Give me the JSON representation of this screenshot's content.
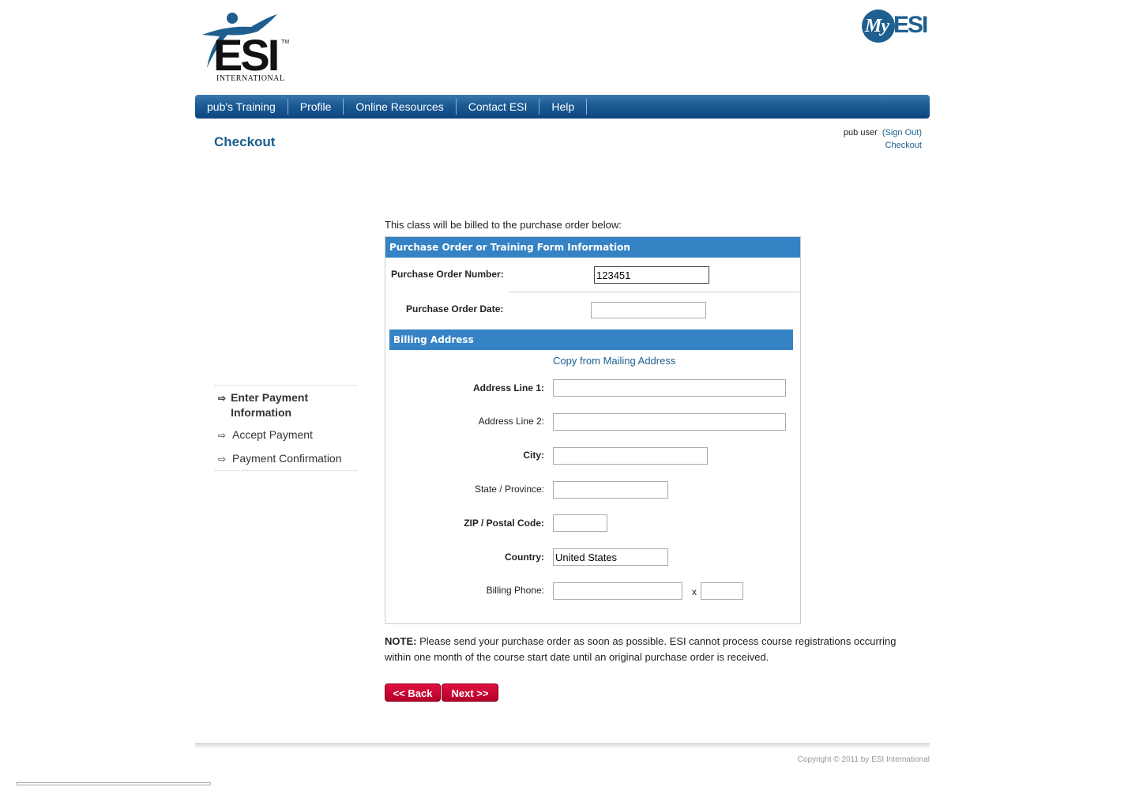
{
  "logo": {
    "text": "ESI",
    "tm": "TM",
    "sub": "INTERNATIONAL"
  },
  "myesi": {
    "my": "My",
    "esi": "ESI"
  },
  "nav": [
    "pub's Training",
    "Profile",
    "Online Resources",
    "Contact ESI",
    "Help"
  ],
  "page_title": "Checkout",
  "user": {
    "name": "pub user",
    "sign_out": "(Sign Out)",
    "crumb": "Checkout"
  },
  "steps": [
    "Enter Payment Information",
    "Accept Payment",
    "Payment Confirmation"
  ],
  "intro": "This class will be billed to the purchase order below:",
  "po_section": {
    "title": "Purchase Order or Training Form Information",
    "po_number_label": "Purchase Order Number:",
    "po_number_value": "123451",
    "po_date_label": "Purchase Order Date:",
    "po_date_value": ""
  },
  "billing": {
    "title": "Billing Address",
    "copy_link": "Copy from Mailing Address",
    "address1_label": "Address Line 1:",
    "address2_label": "Address Line 2:",
    "city_label": "City:",
    "state_label": "State / Province:",
    "zip_label": "ZIP / Postal Code:",
    "country_label": "Country:",
    "country_value": "United States",
    "phone_label": "Billing Phone:",
    "ext_label": "x"
  },
  "note": {
    "label": "NOTE:",
    "text": "Please send your purchase order as soon as possible. ESI cannot process course registrations occurring within one month of the course start date until an original purchase order is received."
  },
  "buttons": {
    "back": "<< Back",
    "next": "Next >>"
  },
  "footer": {
    "copyright": "Copyright © 2011 by ESI International"
  },
  "colors": {
    "nav": "#1b5a93",
    "section": "#3582c4",
    "button": "#d0002f",
    "title": "#1c5e8f"
  }
}
